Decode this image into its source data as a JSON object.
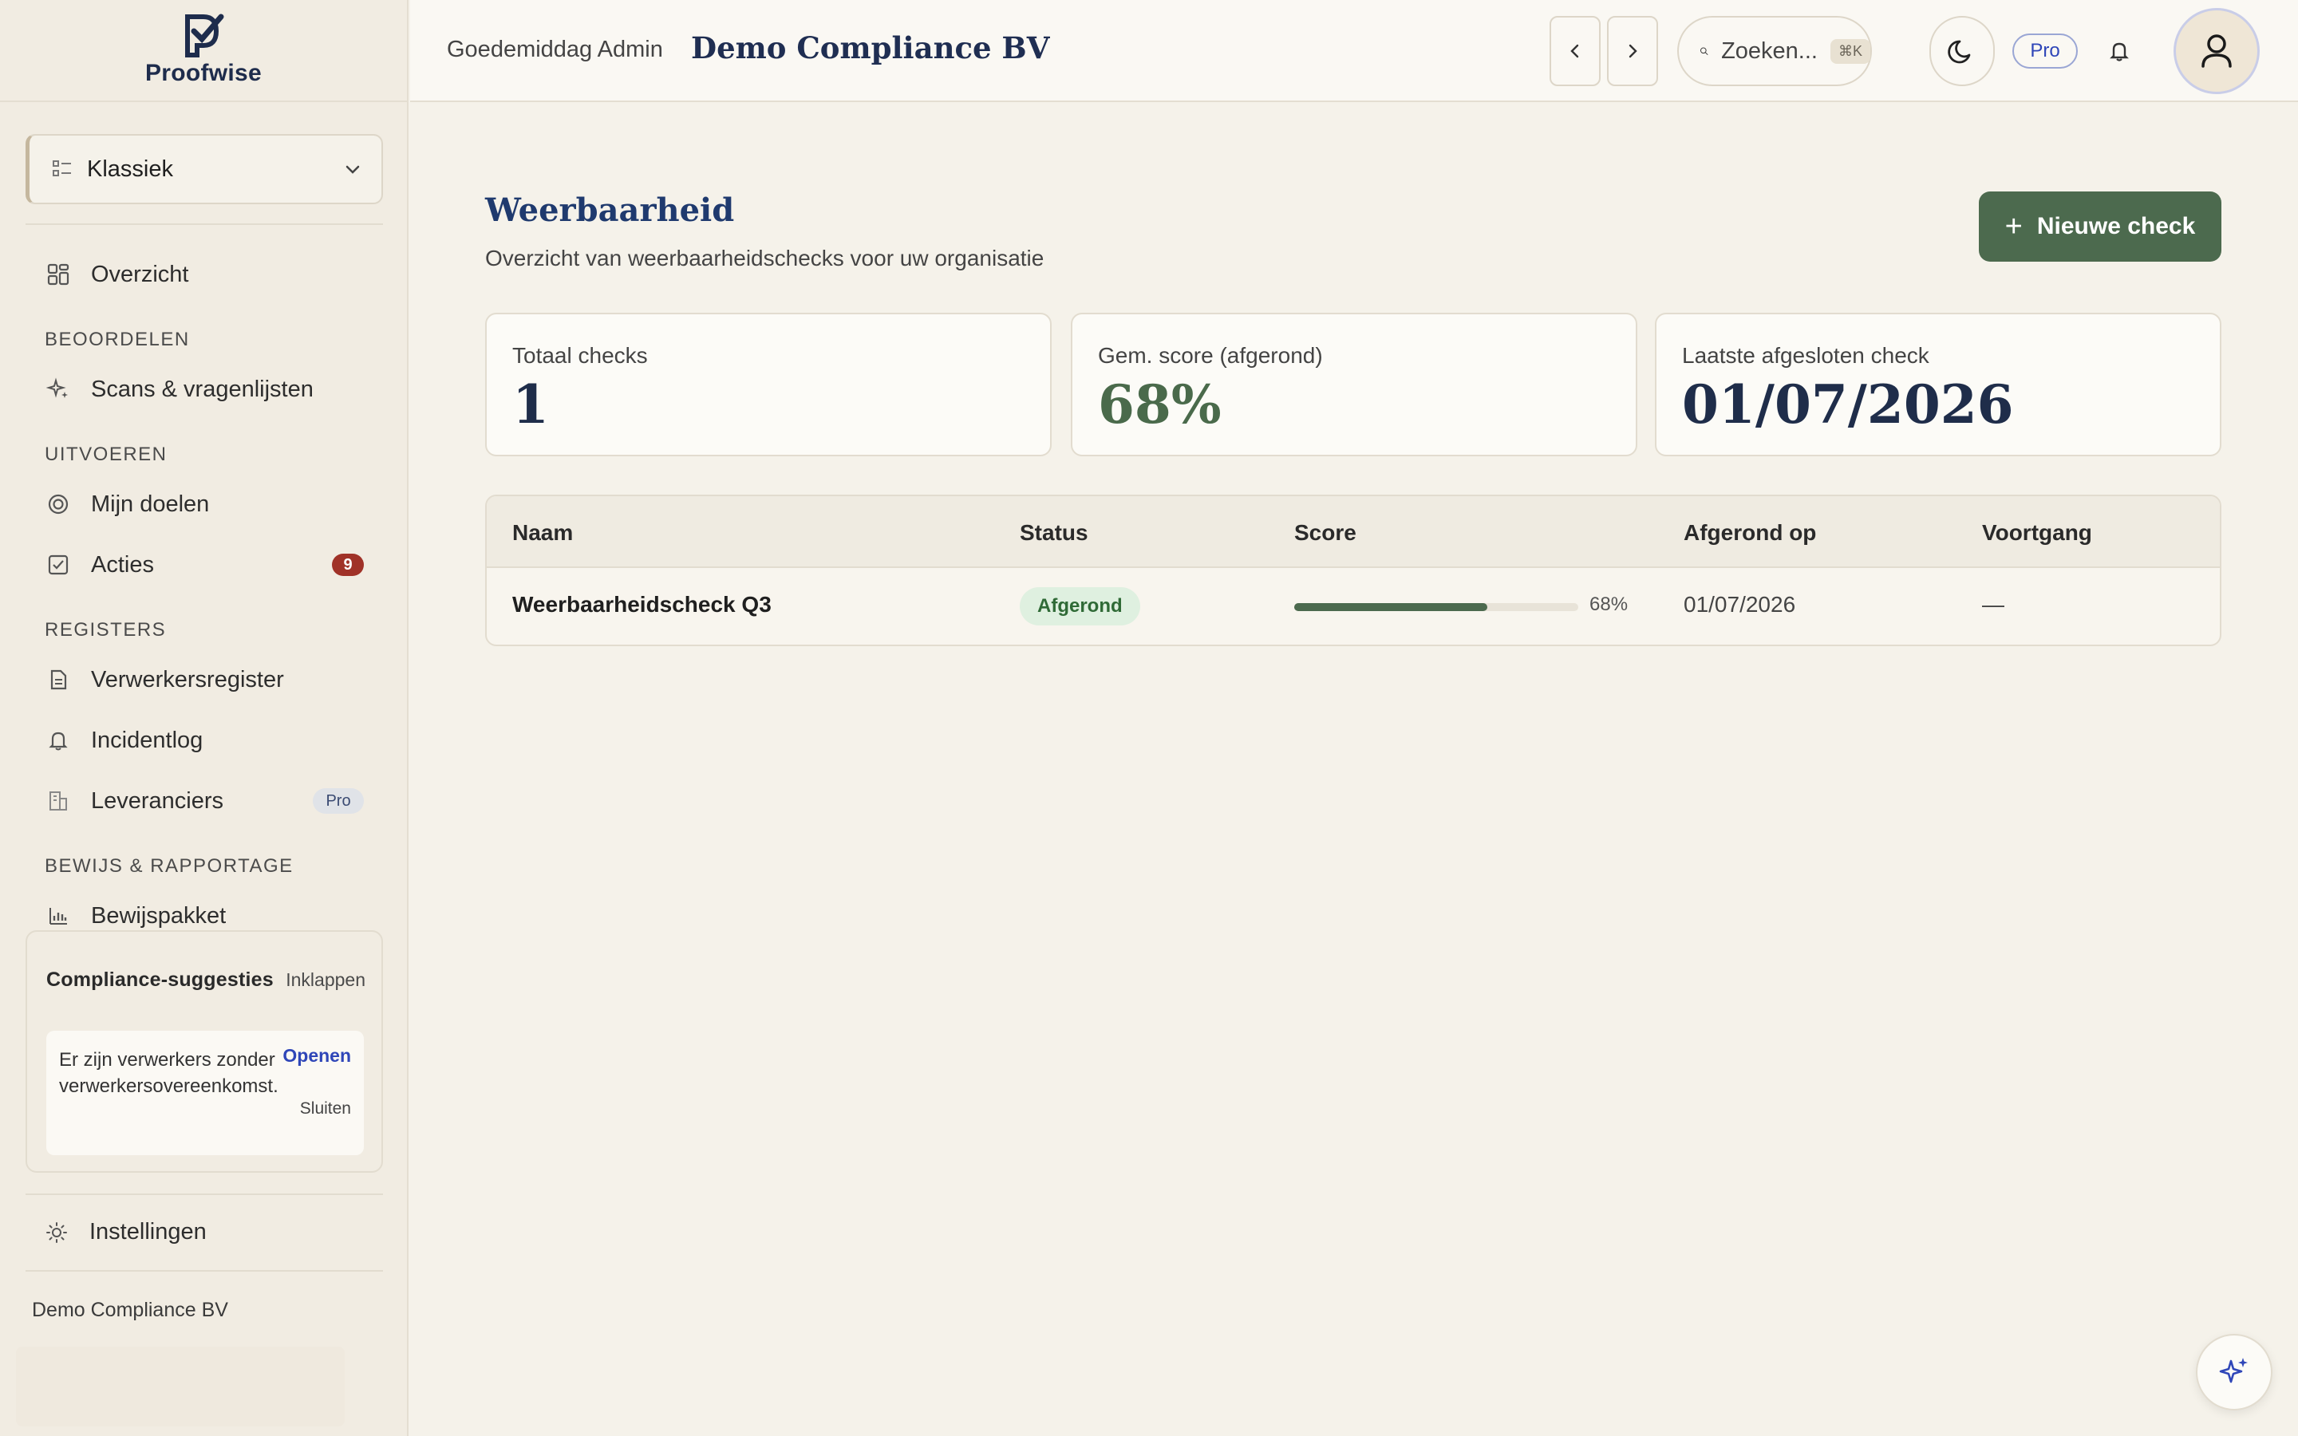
{
  "app": {
    "brand": "Proofwise"
  },
  "sidebar": {
    "mode": "Klassiek",
    "overview": "Overzicht",
    "sections": {
      "assess": "BEOORDELEN",
      "execute": "UITVOEREN",
      "registers": "REGISTERS",
      "evidence": "BEWIJS & RAPPORTAGE"
    },
    "items": {
      "scans": "Scans & vragenlijsten",
      "goals": "Mijn doelen",
      "actions": "Acties",
      "actions_badge": "9",
      "processors": "Verwerkersregister",
      "incidents": "Incidentlog",
      "suppliers": "Leveranciers",
      "suppliers_badge": "Pro",
      "evidence": "Bewijspakket"
    },
    "suggestions": {
      "title": "Compliance-suggesties",
      "collapse": "Inklappen",
      "message": "Er zijn verwerkers zonder verwerkersovereenkomst.",
      "open": "Openen",
      "close": "Sluiten"
    },
    "settings": "Instellingen",
    "org": "Demo Compliance BV"
  },
  "header": {
    "greeting": "Goedemiddag Admin",
    "org": "Demo Compliance BV",
    "search_placeholder": "Zoeken...",
    "search_shortcut": "⌘K",
    "plan": "Pro"
  },
  "main": {
    "title": "Weerbaarheid",
    "subtitle": "Overzicht van weerbaarheidschecks voor uw organisatie",
    "new_button": "Nieuwe check",
    "stats": [
      {
        "label": "Totaal checks",
        "value": "1"
      },
      {
        "label": "Gem. score (afgerond)",
        "value": "68%"
      },
      {
        "label": "Laatste afgesloten check",
        "value": "01/07/2026"
      }
    ],
    "table": {
      "columns": [
        "Naam",
        "Status",
        "Score",
        "Afgerond op",
        "Voortgang"
      ],
      "rows": [
        {
          "name": "Weerbaarheidscheck Q3",
          "status": "Afgerond",
          "score": 68,
          "score_label": "68%",
          "completed": "01/07/2026",
          "progress": "—"
        }
      ]
    }
  },
  "colors": {
    "accent": "#4c6a4e",
    "navy": "#1f3a6e",
    "background": "#f5f2ea"
  }
}
